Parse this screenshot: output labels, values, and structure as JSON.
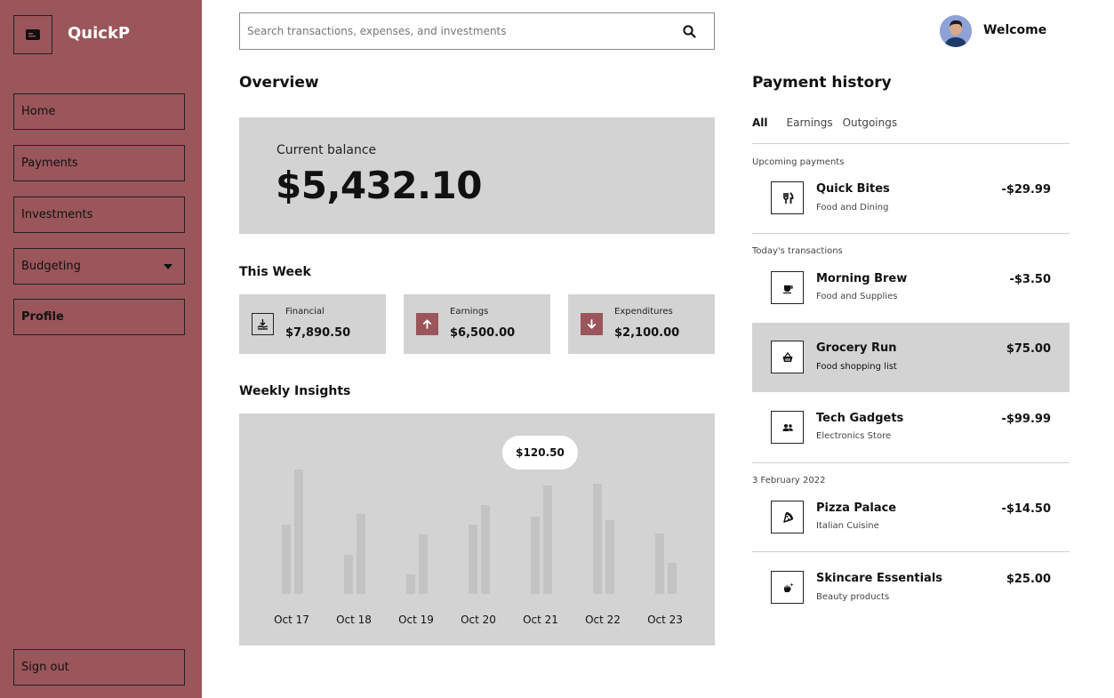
{
  "app": {
    "name": "QuickP",
    "logo_icon": "wallet-card-icon"
  },
  "sidebar": {
    "items": [
      {
        "label": "Home"
      },
      {
        "label": "Payments"
      },
      {
        "label": "Investments"
      },
      {
        "label": "Budgeting",
        "has_dropdown": true
      },
      {
        "label": "Profile"
      }
    ],
    "sign_out": "Sign out",
    "color": "#9a565b"
  },
  "search": {
    "placeholder": "Search transactions, expenses, and investments",
    "value": ""
  },
  "user": {
    "greeting": "Welcome"
  },
  "overview": {
    "title": "Overview",
    "balance_label": "Current balance",
    "balance_value": "$5,432.10"
  },
  "this_week": {
    "title": "This Week",
    "stats": [
      {
        "label": "Financial",
        "value": "$7,890.50",
        "icon": "hand-coin-icon"
      },
      {
        "label": "Earnings",
        "value": "$6,500.00",
        "icon": "arrow-up-icon"
      },
      {
        "label": "Expenditures",
        "value": "$2,100.00",
        "icon": "arrow-down-icon"
      }
    ]
  },
  "weekly_insights": {
    "title": "Weekly Insights",
    "tooltip": "$120.50"
  },
  "chart_data": {
    "type": "bar",
    "categories": [
      "Oct 17",
      "Oct 18",
      "Oct 19",
      "Oct 20",
      "Oct 21",
      "Oct 22",
      "Oct 23"
    ],
    "series": [
      {
        "values": [
          78,
          44,
          22,
          78,
          87,
          124,
          68
        ]
      },
      {
        "values": [
          140,
          90,
          67,
          100,
          122,
          83,
          35
        ]
      }
    ],
    "ylim": [
      0,
      150
    ],
    "grid": false
  },
  "payment_history": {
    "title": "Payment history",
    "tabs": [
      {
        "label": "All",
        "active": true
      },
      {
        "label": "Earnings",
        "active": false
      },
      {
        "label": "Outgoings",
        "active": false
      }
    ],
    "sections": [
      {
        "label": "Upcoming payments"
      },
      {
        "label": "Today's transactions"
      },
      {
        "label": "3 February 2022"
      }
    ],
    "transactions": [
      {
        "name": "Quick Bites",
        "category": "Food and Dining",
        "amount": "-$29.99",
        "icon": "utensils-icon"
      },
      {
        "name": "Morning Brew",
        "category": "Food and Supplies",
        "amount": "-$3.50",
        "icon": "coffee-cup-icon"
      },
      {
        "name": "Grocery Run",
        "category": "Food shopping list",
        "amount": "$75.00",
        "icon": "basket-icon",
        "highlighted": true
      },
      {
        "name": "Tech Gadgets",
        "category": "Electronics Store",
        "amount": "-$99.99",
        "icon": "users-icon"
      },
      {
        "name": "Pizza Palace",
        "category": "Italian Cuisine",
        "amount": "-$14.50",
        "icon": "pizza-icon"
      },
      {
        "name": "Skincare Essentials",
        "category": "Beauty products",
        "amount": "$25.00",
        "icon": "hand-sparkle-icon"
      }
    ]
  },
  "colors": {
    "accent": "#9a565b",
    "card": "#d3d3d3",
    "bar": "#c3c3c3"
  }
}
